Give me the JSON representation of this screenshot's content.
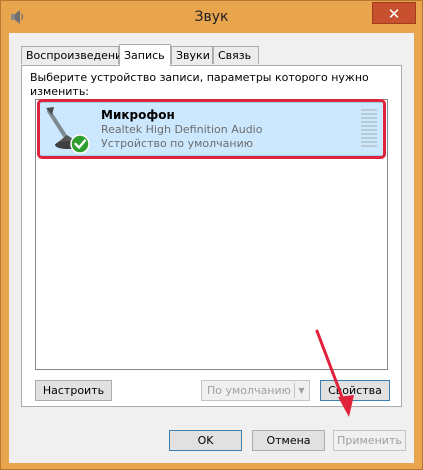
{
  "window": {
    "title": "Звук",
    "close_glyph": "✕",
    "icon": "speaker-icon"
  },
  "tabs": [
    {
      "label": "Воспроизведение",
      "active": false
    },
    {
      "label": "Запись",
      "active": true
    },
    {
      "label": "Звуки",
      "active": false
    },
    {
      "label": "Связь",
      "active": false
    }
  ],
  "recording": {
    "instruction": "Выберите устройство записи, параметры которого нужно изменить:",
    "devices": [
      {
        "name": "Микрофон",
        "driver": "Realtek High Definition Audio",
        "status": "Устройство по умолчанию",
        "icon": "microphone-icon",
        "badge": "default-checkmark-icon"
      }
    ],
    "configure_label": "Настроить",
    "set_default_label": "По умолчанию",
    "properties_label": "Свойства"
  },
  "dialog": {
    "ok_label": "OK",
    "cancel_label": "Отмена",
    "apply_label": "Применить"
  },
  "colors": {
    "frame": "#e8a54e",
    "close_button": "#c7502f",
    "selection": "#cce8ff",
    "annotation": "#e0223a"
  }
}
